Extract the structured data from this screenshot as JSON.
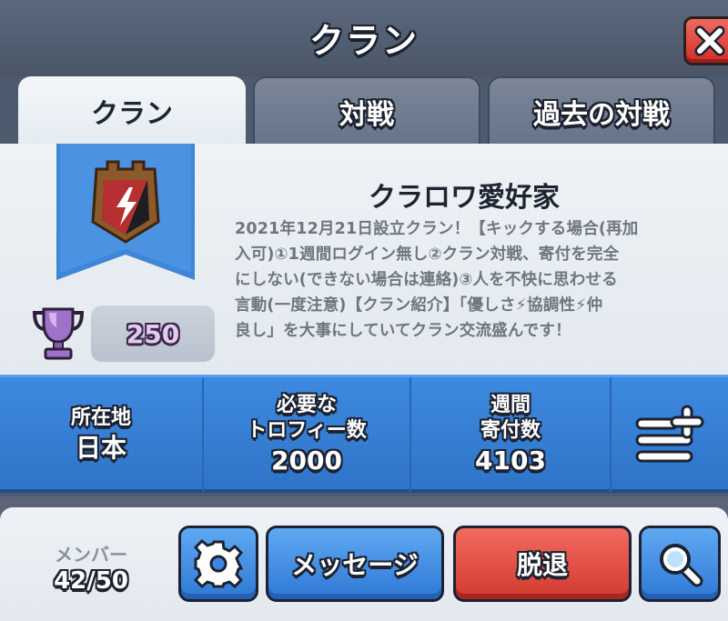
{
  "header": {
    "title": "クラン",
    "close_icon": "close-icon"
  },
  "tabs": [
    {
      "label": "クラン",
      "active": true
    },
    {
      "label": "対戦",
      "active": false
    },
    {
      "label": "過去の対戦",
      "active": false
    }
  ],
  "clan": {
    "name": "クラロワ愛好家",
    "description": "2021年12月21日設立クラン！【キックする場合(再加\n入可)①1週間ログイン無し②クラン対戦、寄付を完全\nにしない(できない場合は連絡)③人を不快に思わせる\n言動(一度注意)【クラン紹介】「優しさ⚡協調性⚡仲\n良し」を大事にしていてクラン交流盛んです！",
    "badge_icon": "clan-badge-icon",
    "trophies": "250",
    "trophy_icon": "trophy-icon"
  },
  "stats": {
    "location_label": "所在地",
    "location_value": "日本",
    "required_label": "必要な\nトロフィー数",
    "required_value": "2000",
    "donations_label": "週間\n寄付数",
    "donations_value": "4103",
    "menu_icon": "add-list-icon"
  },
  "footer": {
    "members_label": "メンバー",
    "members_count": "42/50",
    "settings_icon": "gear-icon",
    "message_label": "メッセージ",
    "leave_label": "脱退",
    "search_icon": "search-icon"
  },
  "colors": {
    "accent_blue": "#2f78d5",
    "accent_red": "#d13a2f",
    "trophy_purple": "#a071c8"
  }
}
